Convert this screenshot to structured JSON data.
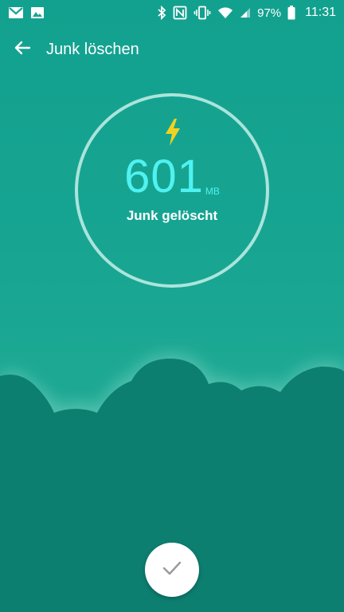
{
  "status_bar": {
    "battery": "97%",
    "time": "11:31",
    "icons": [
      "gmail-icon",
      "image-icon",
      "bluetooth-icon",
      "nfc-icon",
      "vibrate-icon",
      "wifi-icon",
      "signal-icon",
      "battery-icon"
    ]
  },
  "app_bar": {
    "title": "Junk löschen",
    "back_icon": "arrow-back-icon"
  },
  "result": {
    "amount": "601",
    "unit": "MB",
    "caption": "Junk gelöscht",
    "icon": "lightning-bolt-icon"
  },
  "confirm": {
    "icon": "checkmark-icon"
  },
  "colors": {
    "background": "#17a592",
    "cloud": "#0d7f71",
    "amount": "#4ff2f0",
    "bolt": "#f3d21f"
  }
}
